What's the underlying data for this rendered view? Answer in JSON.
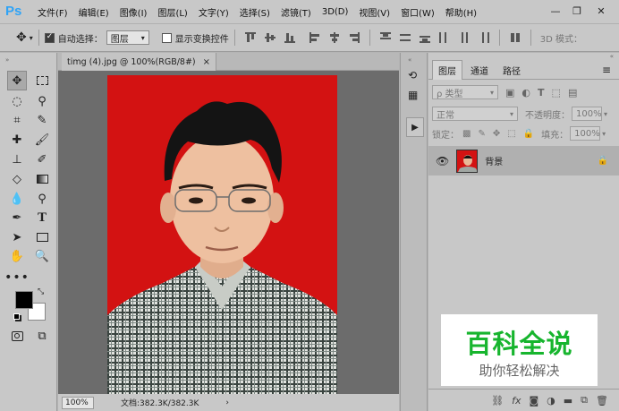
{
  "app": {
    "logo": "Ps"
  },
  "menu": [
    "文件(F)",
    "编辑(E)",
    "图像(I)",
    "图层(L)",
    "文字(Y)",
    "选择(S)",
    "滤镜(T)",
    "3D(D)",
    "视图(V)",
    "窗口(W)",
    "帮助(H)"
  ],
  "window_controls": {
    "minimize": "—",
    "restore": "❐",
    "close": "✕"
  },
  "options": {
    "auto_select_label": "自动选择：",
    "auto_select_checked": true,
    "auto_select_value": "图层",
    "transform_label": "显示变换控件",
    "transform_checked": false,
    "mode_3d_label": "3D 模式："
  },
  "document": {
    "tab_title": "timg (4).jpg @ 100%(RGB/8#)",
    "tab_close": "×",
    "zoom": "100%",
    "doc_info": "文档:382.3K/382.3K"
  },
  "panel": {
    "tabs": [
      "图层",
      "通道",
      "路径"
    ],
    "active_tab": 0,
    "filter_kind": "ρ 类型",
    "blend_mode": "正常",
    "opacity_label": "不透明度：",
    "opacity_value": "100%",
    "lock_label": "锁定：",
    "fill_label": "填充：",
    "fill_value": "100%",
    "layers": [
      {
        "name": "背景",
        "visible": true,
        "locked": true
      }
    ],
    "bottom_icons": [
      "link-icon",
      "fx-icon",
      "mask-icon",
      "adjustment-icon",
      "folder-icon",
      "new-layer-icon",
      "trash-icon"
    ],
    "fx_label": "fx"
  },
  "watermark": {
    "title": "百科全说",
    "subtitle": "助你轻松解决"
  },
  "colors": {
    "canvas_bg": "#d31212",
    "ps_blue": "#2fa3f6",
    "watermark_green": "#17b52e"
  }
}
